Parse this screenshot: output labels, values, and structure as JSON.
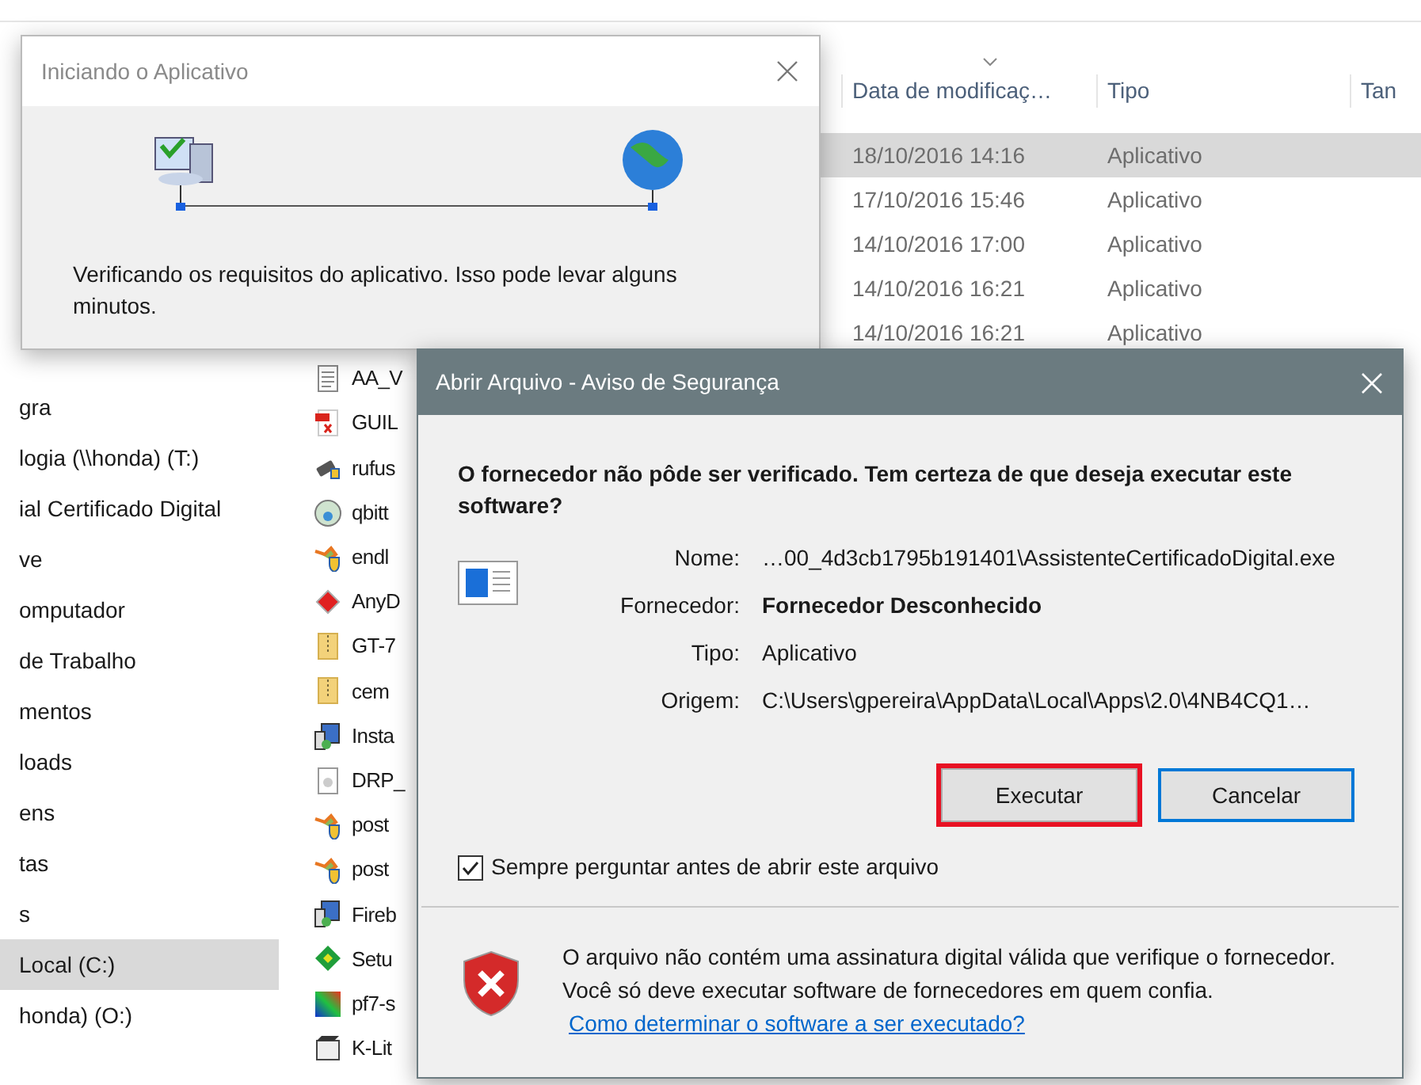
{
  "explorer": {
    "columns": [
      "Data de modificaç…",
      "Tipo",
      "Tan"
    ],
    "sidebar_items": [
      {
        "label": "gra",
        "selected": false
      },
      {
        "label": "logia (\\\\honda) (T:)",
        "selected": false
      },
      {
        "label": "ial Certificado Digital",
        "selected": false
      },
      {
        "label": "ve",
        "selected": false
      },
      {
        "label": "omputador",
        "selected": false
      },
      {
        "label": "de Trabalho",
        "selected": false
      },
      {
        "label": "mentos",
        "selected": false
      },
      {
        "label": "loads",
        "selected": false
      },
      {
        "label": "ens",
        "selected": false
      },
      {
        "label": "tas",
        "selected": false
      },
      {
        "label": "s",
        "selected": false
      },
      {
        "label": "Local (C:)",
        "selected": true
      },
      {
        "label": "honda) (O:)",
        "selected": false
      }
    ],
    "files": [
      {
        "date": "18/10/2016 14:16",
        "type": "Aplicativo",
        "selected": true
      },
      {
        "date": "17/10/2016 15:46",
        "type": "Aplicativo",
        "selected": false
      },
      {
        "date": "14/10/2016 17:00",
        "type": "Aplicativo",
        "selected": false
      },
      {
        "date": "14/10/2016 16:21",
        "type": "Aplicativo",
        "selected": false
      },
      {
        "date": "14/10/2016 16:21",
        "type": "Aplicativo",
        "selected": false
      },
      {
        "name": "AA_V",
        "kind": "text",
        "selected": false
      },
      {
        "name": "GUIL",
        "kind": "pdf",
        "selected": false
      },
      {
        "name": "rufus",
        "kind": "usb",
        "selected": false
      },
      {
        "name": "qbitt",
        "kind": "globe",
        "selected": false
      },
      {
        "name": "endl",
        "kind": "tool",
        "selected": false
      },
      {
        "name": "AnyD",
        "kind": "diamond",
        "selected": false
      },
      {
        "name": "GT-7",
        "kind": "zip",
        "selected": false
      },
      {
        "name": "cem",
        "kind": "zip",
        "selected": false
      },
      {
        "name": "Insta",
        "kind": "installer",
        "selected": false
      },
      {
        "name": "DRP_",
        "kind": "disc",
        "selected": false
      },
      {
        "name": "post",
        "kind": "tool",
        "selected": false
      },
      {
        "name": "post",
        "kind": "tool",
        "selected": false
      },
      {
        "name": "Fireb",
        "kind": "installer",
        "selected": false
      },
      {
        "name": "Setu",
        "kind": "box",
        "selected": false
      },
      {
        "name": "pf7-s",
        "kind": "image",
        "selected": false
      },
      {
        "name": "K-Lit",
        "kind": "media",
        "selected": false
      }
    ]
  },
  "startup_dialog": {
    "title": "Iniciando o Aplicativo",
    "message": "Verificando os requisitos do aplicativo. Isso pode levar alguns minutos."
  },
  "security_dialog": {
    "title": "Abrir Arquivo - Aviso de Segurança",
    "heading": "O fornecedor não pôde ser verificado. Tem certeza de que deseja executar este software?",
    "fields": [
      {
        "label": "Nome:",
        "value": "…00_4d3cb1795b191401\\AssistenteCertificadoDigital.exe",
        "kind": "plain"
      },
      {
        "label": "Fornecedor:",
        "value": "Fornecedor Desconhecido",
        "kind": "bold"
      },
      {
        "label": "Tipo:",
        "value": "Aplicativo",
        "kind": "plain"
      },
      {
        "label": "Origem:",
        "value": "C:\\Users\\gpereira\\AppData\\Local\\Apps\\2.0\\4NB4CQ1…",
        "kind": "plain"
      }
    ],
    "buttons": [
      {
        "label": "Executar",
        "highlighted": true,
        "focused": false
      },
      {
        "label": "Cancelar",
        "highlighted": false,
        "focused": true
      }
    ],
    "checkbox": {
      "label": "Sempre perguntar antes de abrir este arquivo",
      "checked": true
    },
    "warning": "O arquivo não contém uma assinatura digital válida que verifique o fornecedor. Você só deve executar software de fornecedores em quem confia.",
    "link": "Como determinar o software a ser executado?"
  }
}
